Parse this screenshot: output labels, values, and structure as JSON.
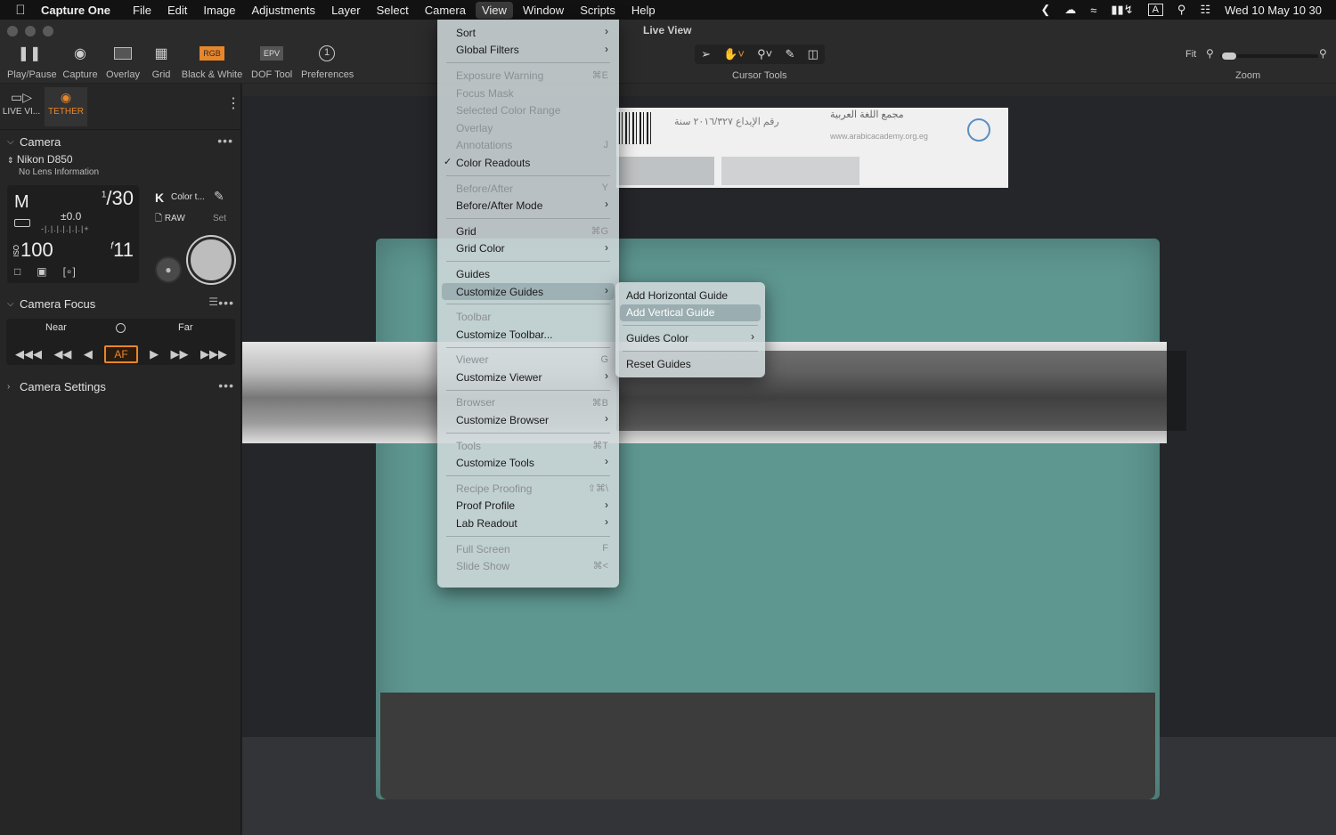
{
  "menubar": {
    "apple": "",
    "app_name": "Capture One",
    "menus": [
      "File",
      "Edit",
      "Image",
      "Adjustments",
      "Layer",
      "Select",
      "Camera",
      "View",
      "Window",
      "Scripts",
      "Help"
    ],
    "active_menu": "View",
    "status": {
      "input_source": "A",
      "datetime": "Wed 10 May  10 30"
    }
  },
  "window": {
    "title": "Live View"
  },
  "toolbar": {
    "buttons": [
      {
        "label": "Play/Pause",
        "icon": "pause-icon"
      },
      {
        "label": "Capture",
        "icon": "camera-icon"
      },
      {
        "label": "Overlay",
        "icon": "overlay-icon"
      },
      {
        "label": "Grid",
        "icon": "grid-icon"
      },
      {
        "label": "Black & White",
        "icon": "rgb-icon",
        "icon_text": "RGB"
      },
      {
        "label": "DOF Tool",
        "icon": "epv-icon",
        "icon_text": "EPV"
      },
      {
        "label": "Preferences",
        "icon": "info-circle-icon"
      }
    ],
    "cursor_tools_label": "Cursor Tools",
    "zoom": {
      "fit_label": "Fit",
      "label": "Zoom",
      "value": 0.02
    }
  },
  "sidebar": {
    "tabs": [
      {
        "label": "LIVE VI...",
        "icon": "live-view-icon"
      },
      {
        "label": "TETHER",
        "icon": "tether-camera-icon",
        "active": true
      }
    ],
    "camera": {
      "title": "Camera",
      "model": "Nikon D850",
      "lens": "No Lens Information",
      "mode": "M",
      "shutter_num": "1",
      "shutter_den": "30",
      "exposure_comp": "±0.0",
      "exposure_scale": "-|.|.|.|.|.|.|+",
      "iso_label": "ISO",
      "iso": "100",
      "aperture_prefix": "f",
      "aperture": "11",
      "wb_letter": "K",
      "wb_text": "Color t...",
      "format": "RAW",
      "set_label": "Set"
    },
    "focus": {
      "title": "Camera Focus",
      "near": "Near",
      "far": "Far",
      "af_label": "AF"
    },
    "settings": {
      "title": "Camera Settings"
    }
  },
  "photo": {
    "box_text_right": "مجمع اللغة العربية",
    "box_text_mid": "رقم الإيداع ٢٠١٦/٣٢٧ سنة",
    "box_url": "www.arabicacademy.org.eg"
  },
  "view_menu": {
    "items": [
      {
        "label": "Sort",
        "submenu": true
      },
      {
        "label": "Global Filters",
        "submenu": true
      },
      {
        "sep": true
      },
      {
        "label": "Exposure Warning",
        "disabled": true,
        "shortcut": "⌘E"
      },
      {
        "label": "Focus Mask",
        "disabled": true
      },
      {
        "label": "Selected Color Range",
        "disabled": true
      },
      {
        "label": "Overlay",
        "disabled": true
      },
      {
        "label": "Annotations",
        "disabled": true,
        "shortcut": "J"
      },
      {
        "label": "Color Readouts",
        "checked": true
      },
      {
        "sep": true
      },
      {
        "label": "Before/After",
        "disabled": true,
        "shortcut": "Y"
      },
      {
        "label": "Before/After Mode",
        "submenu": true
      },
      {
        "sep": true
      },
      {
        "label": "Grid",
        "shortcut": "⌘G"
      },
      {
        "label": "Grid Color",
        "submenu": true
      },
      {
        "sep": true
      },
      {
        "label": "Guides"
      },
      {
        "label": "Customize Guides",
        "submenu": true,
        "highlighted": true
      },
      {
        "sep": true
      },
      {
        "label": "Toolbar",
        "disabled": true
      },
      {
        "label": "Customize Toolbar..."
      },
      {
        "sep": true
      },
      {
        "label": "Viewer",
        "disabled": true,
        "shortcut": "G"
      },
      {
        "label": "Customize Viewer",
        "submenu": true
      },
      {
        "sep": true
      },
      {
        "label": "Browser",
        "disabled": true,
        "shortcut": "⌘B"
      },
      {
        "label": "Customize Browser",
        "submenu": true
      },
      {
        "sep": true
      },
      {
        "label": "Tools",
        "disabled": true,
        "shortcut": "⌘T"
      },
      {
        "label": "Customize Tools",
        "submenu": true
      },
      {
        "sep": true
      },
      {
        "label": "Recipe Proofing",
        "disabled": true,
        "shortcut": "⇧⌘\\"
      },
      {
        "label": "Proof Profile",
        "submenu": true
      },
      {
        "label": "Lab Readout",
        "submenu": true
      },
      {
        "sep": true
      },
      {
        "label": "Full Screen",
        "disabled": true,
        "shortcut": "F"
      },
      {
        "label": "Slide Show",
        "disabled": true,
        "shortcut": "⌘<"
      }
    ]
  },
  "guides_submenu": {
    "items": [
      {
        "label": "Add Horizontal Guide"
      },
      {
        "label": "Add Vertical Guide",
        "highlighted": true
      },
      {
        "sep": true
      },
      {
        "label": "Guides Color",
        "submenu": true
      },
      {
        "sep": true
      },
      {
        "label": "Reset Guides"
      }
    ]
  },
  "colors": {
    "accent": "#e8862b",
    "menu_bg": "#d2dadc",
    "book": "#5e9690"
  }
}
